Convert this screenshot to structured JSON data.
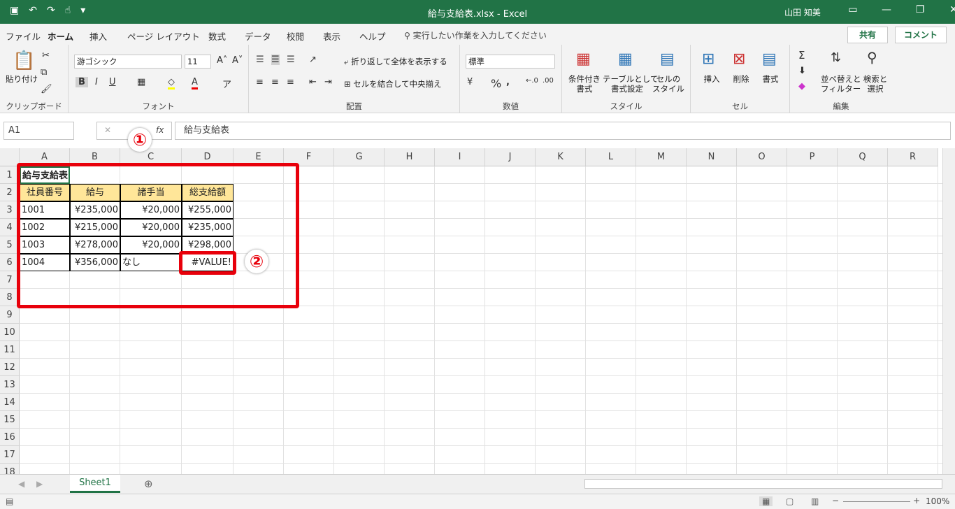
{
  "titlebar": {
    "title": "給与支給表.xlsx  -  Excel",
    "user": "山田 知美"
  },
  "tabs": [
    "ファイル",
    "ホーム",
    "挿入",
    "ページ レイアウト",
    "数式",
    "データ",
    "校閲",
    "表示",
    "ヘルプ"
  ],
  "tellme": "実行したい作業を入力してください",
  "share": "共有",
  "comment": "コメント",
  "ribbon": {
    "paste": "貼り付け",
    "clipboard": "クリップボード",
    "font_name": "游ゴシック",
    "font_size": "11",
    "font": "フォント",
    "wrap": "折り返して全体を表示する",
    "merge": "セルを結合して中央揃え",
    "alignment": "配置",
    "number_format": "標準",
    "number": "数値",
    "cond_fmt": "条件付き\n書式",
    "table_fmt": "テーブルとして\n書式設定",
    "cell_style": "セルの\nスタイル",
    "styles": "スタイル",
    "insert": "挿入",
    "delete": "削除",
    "format": "書式",
    "cells": "セル",
    "sort": "並べ替えと\nフィルター",
    "find": "検索と\n選択",
    "editing": "編集"
  },
  "namebox": "A1",
  "formula": "給与支給表",
  "columns": [
    "A",
    "B",
    "C",
    "D",
    "E",
    "F",
    "G",
    "H",
    "I",
    "J",
    "K",
    "L",
    "M",
    "N",
    "O",
    "P",
    "Q",
    "R"
  ],
  "rows": [
    "1",
    "2",
    "3",
    "4",
    "5",
    "6",
    "7",
    "8",
    "9",
    "10",
    "11",
    "12",
    "13",
    "14",
    "15",
    "16",
    "17",
    "18"
  ],
  "table": {
    "title": "給与支給表",
    "headers": [
      "社員番号",
      "給与",
      "諸手当",
      "総支給額"
    ],
    "data": [
      [
        "1001",
        "¥235,000",
        "¥20,000",
        "¥255,000"
      ],
      [
        "1002",
        "¥215,000",
        "¥20,000",
        "¥235,000"
      ],
      [
        "1003",
        "¥278,000",
        "¥20,000",
        "¥298,000"
      ],
      [
        "1004",
        "¥356,000",
        "なし",
        "#VALUE!"
      ]
    ]
  },
  "badges": [
    "①",
    "②"
  ],
  "sheet": "Sheet1",
  "zoom": "100%"
}
